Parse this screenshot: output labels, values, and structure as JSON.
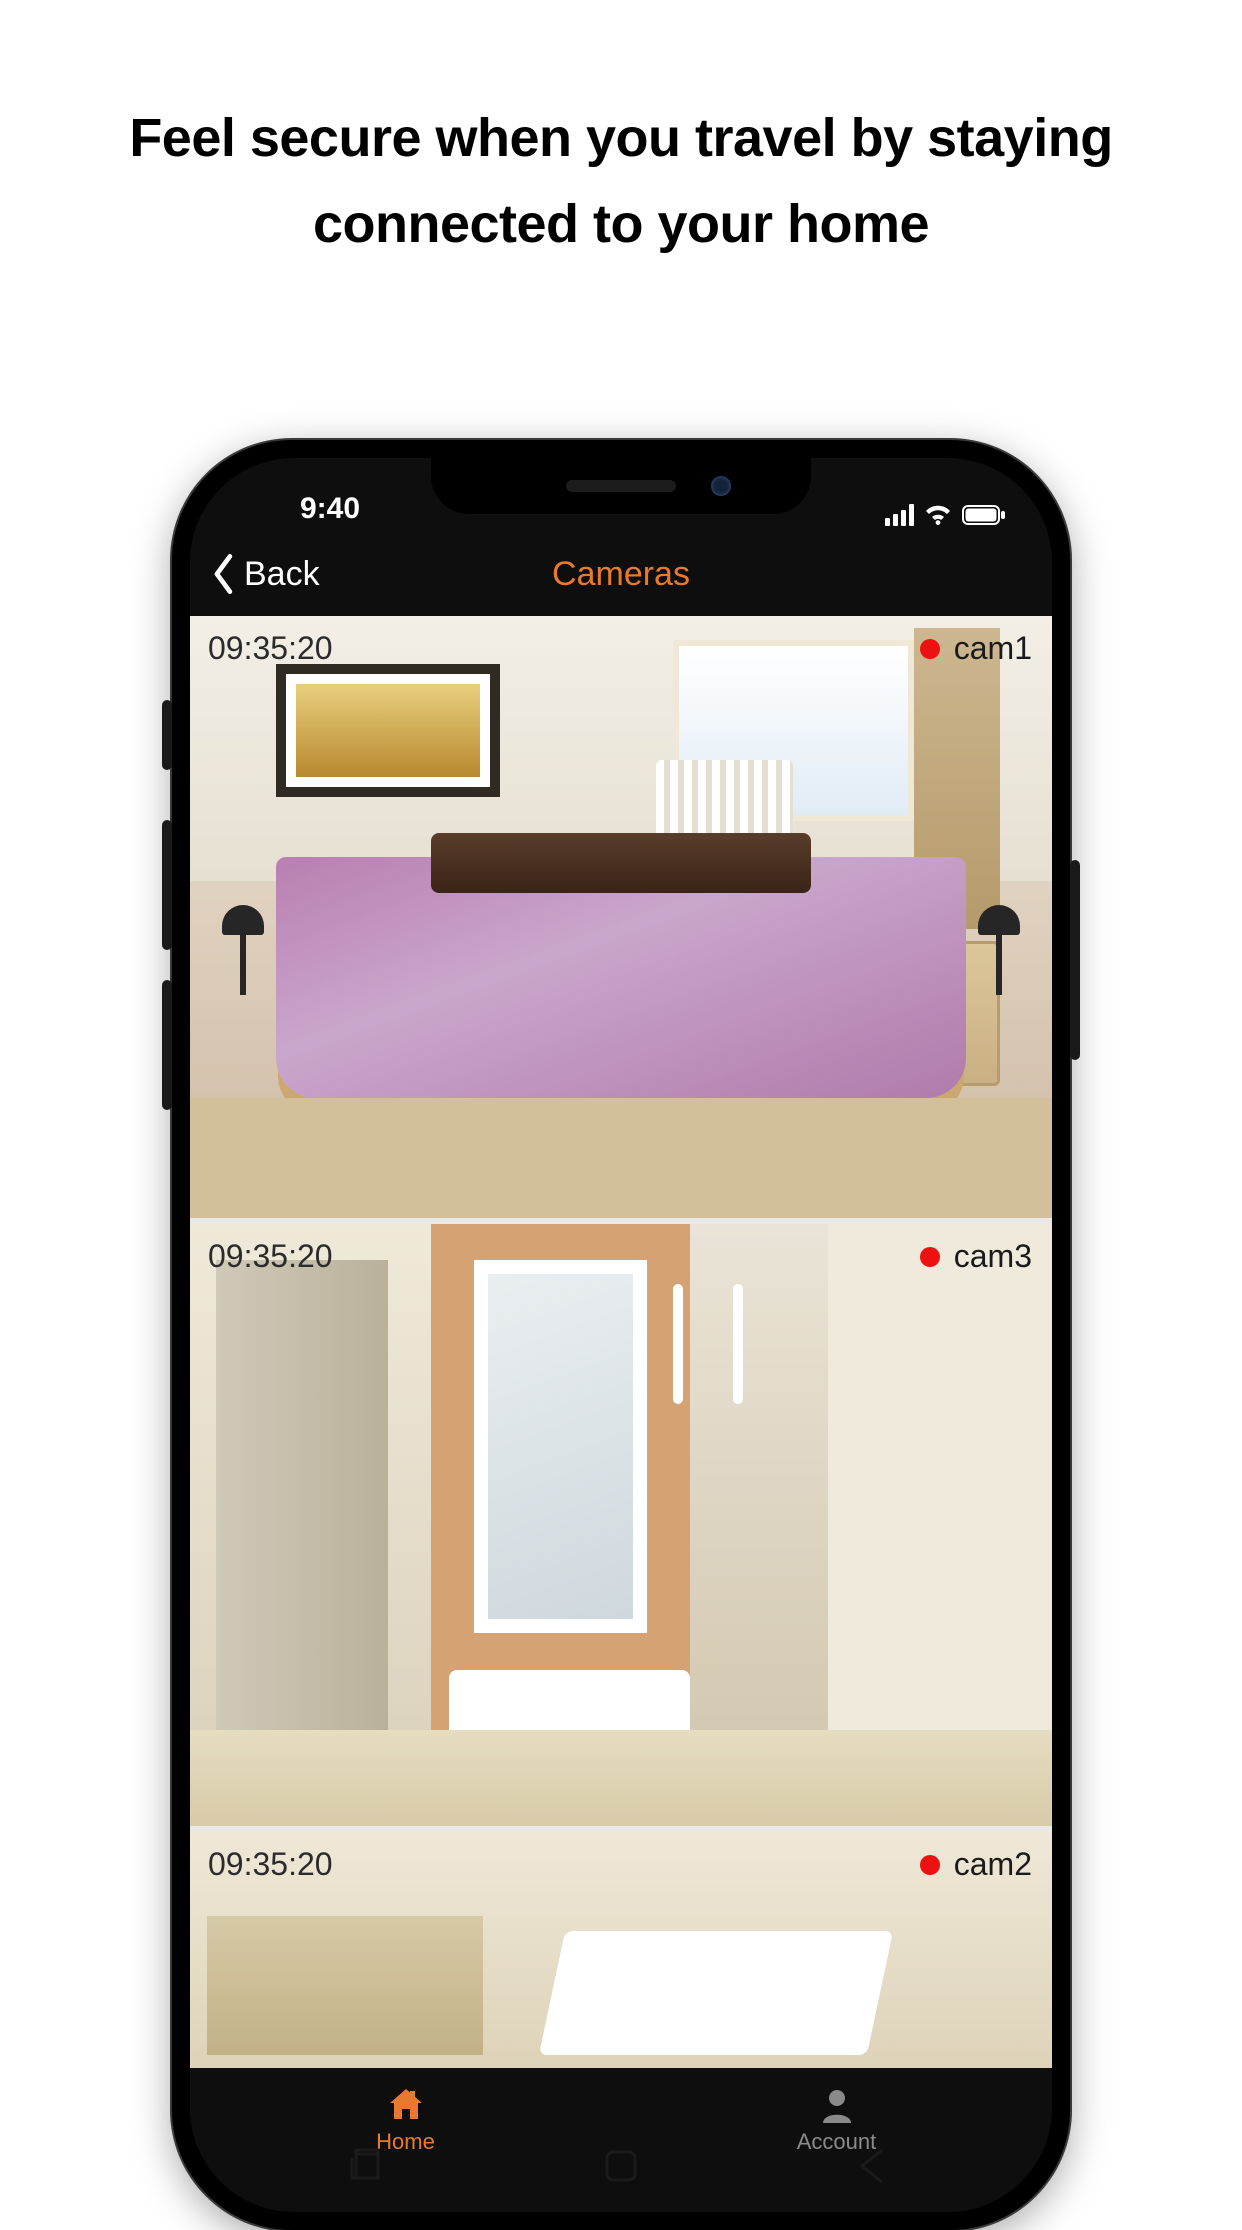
{
  "marketing": {
    "headline": "Feel secure when you travel by staying connected to your home"
  },
  "statusbar": {
    "time": "9:40",
    "signal_icon": "cellular-signal-icon",
    "wifi_icon": "wifi-icon",
    "battery_icon": "battery-icon"
  },
  "navbar": {
    "back_label": "Back",
    "title": "Cameras"
  },
  "cameras": [
    {
      "timestamp": "09:35:20",
      "name": "cam1",
      "recording": true
    },
    {
      "timestamp": "09:35:20",
      "name": "cam3",
      "recording": true
    },
    {
      "timestamp": "09:35:20",
      "name": "cam2",
      "recording": true
    }
  ],
  "tabs": {
    "home": "Home",
    "account": "Account",
    "active": "home"
  },
  "colors": {
    "accent": "#e77a2e",
    "recording": "#ee1111",
    "app_background": "#0e0e0e"
  },
  "softkeys": {
    "recent_icon": "recent-apps-icon",
    "home_icon": "home-softkey-icon",
    "back_icon": "back-softkey-icon"
  }
}
